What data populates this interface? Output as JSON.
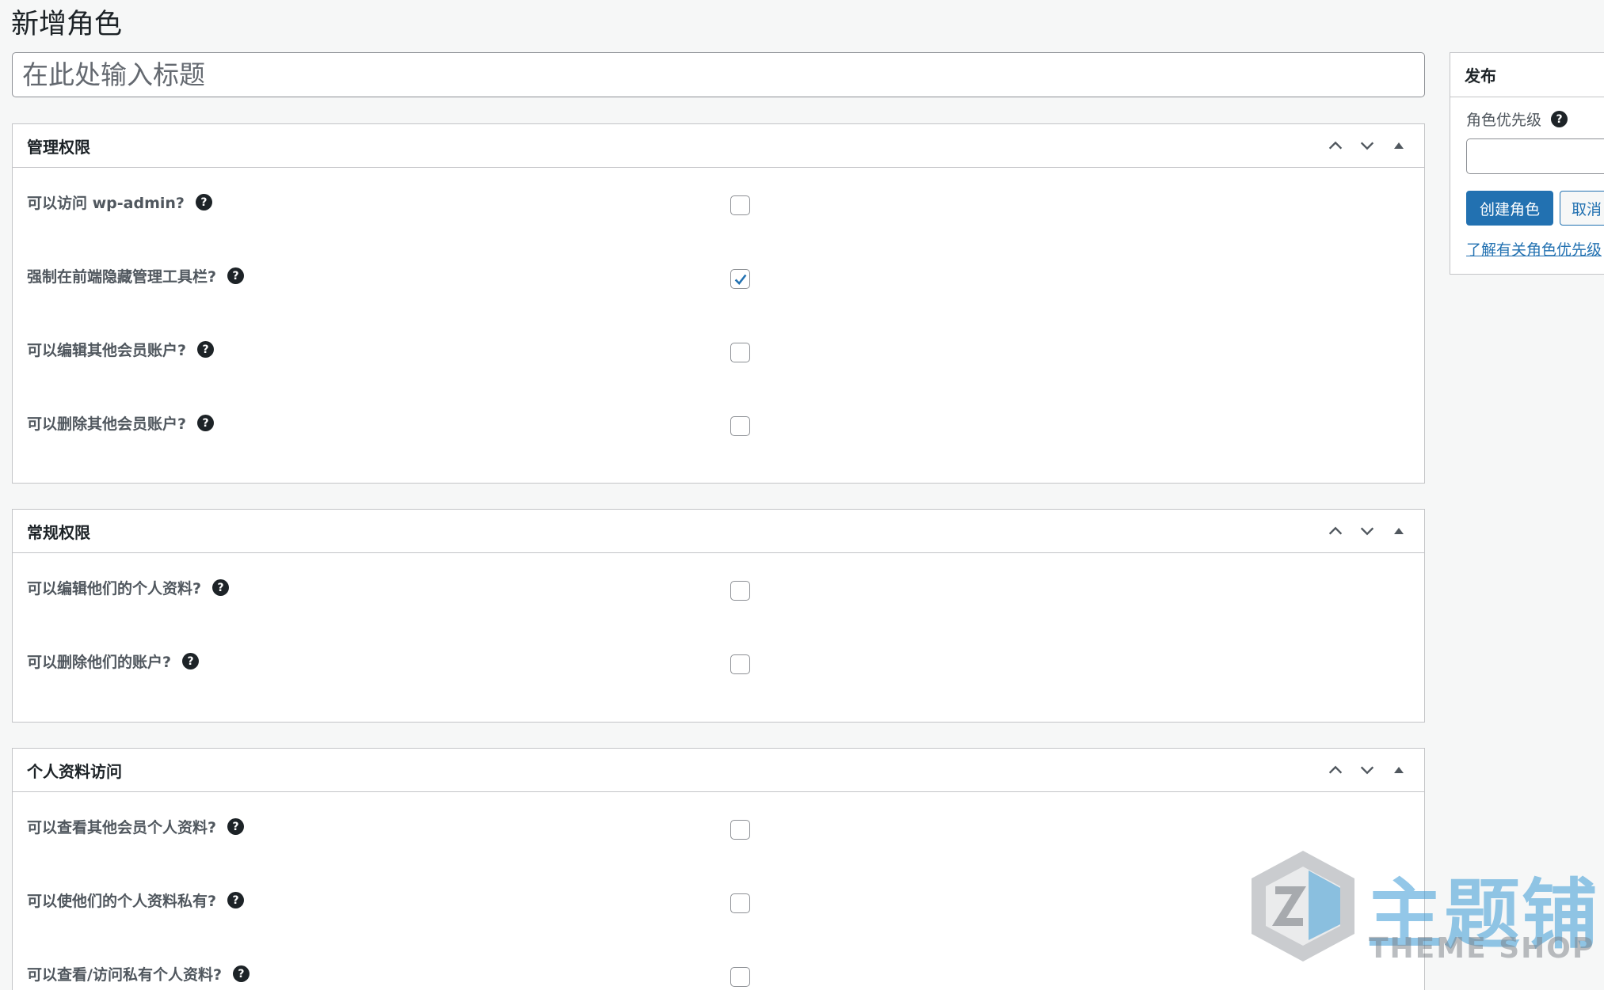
{
  "page": {
    "title": "新增角色"
  },
  "title_input": {
    "placeholder": "在此处输入标题",
    "value": ""
  },
  "sections": [
    {
      "title": "管理权限",
      "fields": [
        {
          "label": "可以访问 wp-admin?",
          "checked": false
        },
        {
          "label": "强制在前端隐藏管理工具栏?",
          "checked": true
        },
        {
          "label": "可以编辑其他会员账户?",
          "checked": false
        },
        {
          "label": "可以删除其他会员账户?",
          "checked": false
        }
      ]
    },
    {
      "title": "常规权限",
      "fields": [
        {
          "label": "可以编辑他们的个人资料?",
          "checked": false
        },
        {
          "label": "可以删除他们的账户?",
          "checked": false
        }
      ]
    },
    {
      "title": "个人资料访问",
      "fields": [
        {
          "label": "可以查看其他会员个人资料?",
          "checked": false
        },
        {
          "label": "可以使他们的个人资料私有?",
          "checked": false
        },
        {
          "label": "可以查看/访问私有个人资料?",
          "checked": false
        }
      ]
    }
  ],
  "publish_box": {
    "title": "发布",
    "priority_label": "角色优先级",
    "priority_value": "",
    "create_button": "创建角色",
    "cancel_button": "取消",
    "learn_link": "了解有关角色优先级"
  },
  "help_icon_glyph": "?",
  "watermark": {
    "main": "主题铺",
    "sub": "THEME SHOP"
  },
  "colors": {
    "accent": "#2271b1",
    "background": "#f6f7f7",
    "border": "#c3c4c7"
  },
  "icons": {
    "move_up": "chevron-up-icon",
    "move_down": "chevron-down-icon",
    "toggle": "triangle-up-icon",
    "help": "help-circle-icon",
    "check": "check-icon"
  }
}
